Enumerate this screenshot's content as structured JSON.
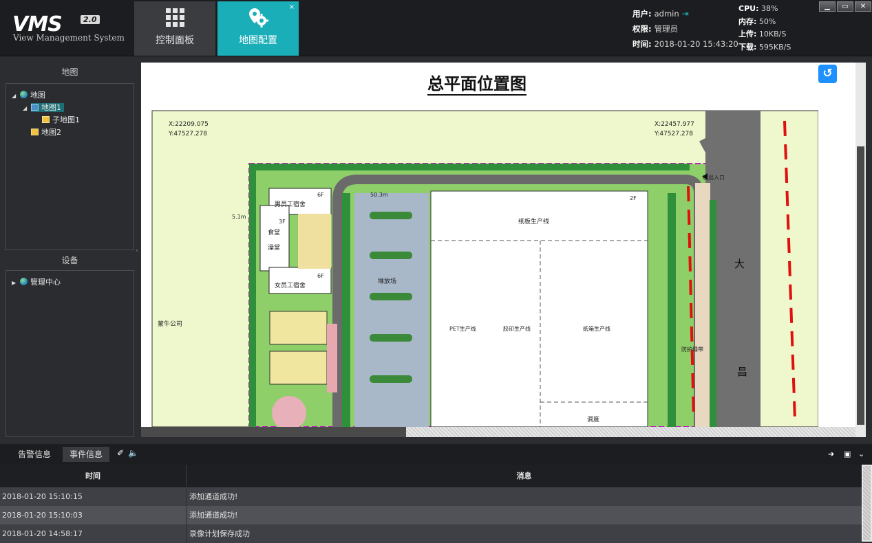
{
  "app": {
    "logo_text": "VMS",
    "logo_version": "2.0",
    "logo_subtitle": "View Management System"
  },
  "tabs": [
    {
      "label": "控制面板",
      "icon": "grid-icon",
      "active": false
    },
    {
      "label": "地图配置",
      "icon": "map-settings-icon",
      "active": true,
      "close": "×"
    }
  ],
  "user": {
    "user_label": "用户:",
    "user_value": "admin",
    "role_label": "权限:",
    "role_value": "管理员",
    "time_label": "时间:",
    "time_value": "2018-01-20 15:43:20"
  },
  "system": {
    "cpu_label": "CPU:",
    "cpu_value": "38%",
    "mem_label": "内存:",
    "mem_value": "50%",
    "up_label": "上传:",
    "up_value": "10KB/S",
    "down_label": "下载:",
    "down_value": "595KB/S"
  },
  "window_controls": [
    "minimize",
    "restore",
    "close"
  ],
  "map_panel": {
    "title": "地图",
    "tree": [
      {
        "label": "地图",
        "level": 0,
        "icon": "globe-icon",
        "expanded": true
      },
      {
        "label": "地图1",
        "level": 1,
        "icon": "map-file-icon",
        "expanded": true,
        "selected": true
      },
      {
        "label": "子地图1",
        "level": 2,
        "icon": "map-file-icon"
      },
      {
        "label": "地图2",
        "level": 1,
        "icon": "map-file-icon"
      }
    ]
  },
  "device_panel": {
    "title": "设备",
    "tree": [
      {
        "label": "管理中心",
        "level": 0,
        "icon": "globe-icon",
        "expanded": false
      }
    ]
  },
  "map": {
    "title": "总平面位置图",
    "coord_left_x": "X:22209.075",
    "coord_left_y": "Y:47527.278",
    "coord_right_x": "X:22457.977",
    "coord_right_y": "Y:47527.278",
    "labels": {
      "male_dorm": "男员工宿舍",
      "male_dorm_floors": "6F",
      "female_dorm": "女员工宿舍",
      "female_dorm_floors": "6F",
      "canteen": "食堂",
      "bath": "澡堂",
      "canteen_floors": "3F",
      "storage_yard": "堆放场",
      "cardboard_line": "纸板生产线",
      "factory_floors": "2F",
      "pet_line": "PET生产线",
      "print_line": "胶印生产线",
      "box_line": "纸箱生产线",
      "dispatch": "调度",
      "company": "蒙牛公司",
      "entrance": "次出入口",
      "road_1": "大",
      "road_2": "昌",
      "green_belt": "防护绿带",
      "dim_1": "5.1m",
      "dim_2": "50.3m"
    }
  },
  "bottom": {
    "tabs": [
      {
        "label": "告警信息",
        "active": false
      },
      {
        "label": "事件信息",
        "active": true
      }
    ],
    "columns": {
      "time": "时间",
      "message": "消息"
    },
    "rows": [
      {
        "time": "2018-01-20 15:10:15",
        "message": "添加通道成功!"
      },
      {
        "time": "2018-01-20 15:10:03",
        "message": "添加通道成功!"
      },
      {
        "time": "2018-01-20 14:58:17",
        "message": "录像计划保存成功"
      }
    ]
  }
}
